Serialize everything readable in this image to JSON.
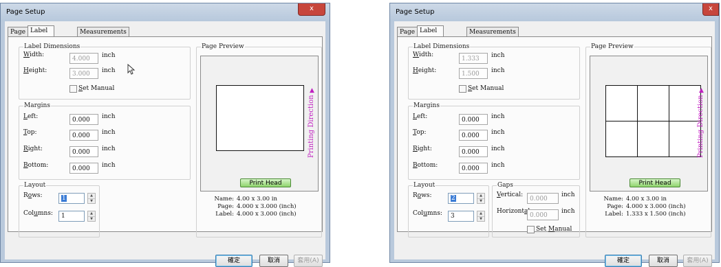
{
  "left": {
    "title": "Page Setup",
    "close_glyph": "x",
    "tabs": [
      "Page",
      "Label Layout",
      "Measurements"
    ],
    "label_dimensions": {
      "group_title": "Label Dimensions",
      "width_label_key": "W",
      "width_label_rest": "idth:",
      "width_value": "4.000",
      "width_unit": "inch",
      "height_label_key": "H",
      "height_label_rest": "eight:",
      "height_value": "3.000",
      "height_unit": "inch",
      "set_manual_key": "S",
      "set_manual_rest": "et Manual"
    },
    "margins": {
      "group_title": "Margins",
      "left_key": "L",
      "left_rest": "eft:",
      "left_value": "0.000",
      "top_key": "T",
      "top_rest": "op:",
      "top_value": "0.000",
      "right_key": "R",
      "right_rest": "ight:",
      "right_value": "0.000",
      "bottom_key": "B",
      "bottom_rest": "ottom:",
      "bottom_value": "0.000",
      "unit": "inch"
    },
    "layout": {
      "group_title": "Layout",
      "rows_label_pre": "R",
      "rows_label_key": "o",
      "rows_label_post": "ws:",
      "rows_value": "1",
      "columns_label_pre": "Col",
      "columns_label_key": "u",
      "columns_label_post": "mns:",
      "columns_value": "1"
    },
    "preview": {
      "group_title": "Page Preview",
      "direction_text": "Printing Direction",
      "print_head": "Print Head",
      "grid_rows": 1,
      "grid_cols": 1,
      "info": [
        {
          "k": "Name:",
          "v": "4.00 x 3.00 in"
        },
        {
          "k": "Page:",
          "v": "4.000 x 3.000 (inch)"
        },
        {
          "k": "Label:",
          "v": "4.000 x 3.000 (inch)"
        }
      ]
    },
    "buttons": {
      "ok": "確定",
      "cancel": "取消",
      "apply": "套用(A)"
    }
  },
  "right": {
    "title": "Page Setup",
    "close_glyph": "x",
    "tabs": [
      "Page",
      "Label Layout",
      "Measurements"
    ],
    "label_dimensions": {
      "group_title": "Label Dimensions",
      "width_label_key": "W",
      "width_label_rest": "idth:",
      "width_value": "1.333",
      "width_unit": "inch",
      "height_label_key": "H",
      "height_label_rest": "eight:",
      "height_value": "1.500",
      "height_unit": "inch",
      "set_manual_key": "S",
      "set_manual_rest": "et Manual"
    },
    "margins": {
      "group_title": "Margins",
      "left_key": "L",
      "left_rest": "eft:",
      "left_value": "0.000",
      "top_key": "T",
      "top_rest": "op:",
      "top_value": "0.000",
      "right_key": "R",
      "right_rest": "ight:",
      "right_value": "0.000",
      "bottom_key": "B",
      "bottom_rest": "ottom:",
      "bottom_value": "0.000",
      "unit": "inch"
    },
    "layout": {
      "group_title": "Layout",
      "rows_label_pre": "R",
      "rows_label_key": "o",
      "rows_label_post": "ws:",
      "rows_value": "2",
      "columns_label_pre": "Col",
      "columns_label_key": "u",
      "columns_label_post": "mns:",
      "columns_value": "3"
    },
    "gaps": {
      "group_title": "Gaps",
      "vertical_key": "V",
      "vertical_rest": "ertical:",
      "vertical_value": "0.000",
      "horizontal_pre": "Horizont",
      "horizontal_key": "a",
      "horizontal_post": "l:",
      "horizontal_value": "0.000",
      "unit": "inch",
      "set_manual_pre": "Set ",
      "set_manual_key": "M",
      "set_manual_post": "anual"
    },
    "preview": {
      "group_title": "Page Preview",
      "direction_text": "Printing Direction",
      "print_head": "Print Head",
      "grid_rows": 2,
      "grid_cols": 3,
      "info": [
        {
          "k": "Name:",
          "v": "4.00 x 3.00 in"
        },
        {
          "k": "Page:",
          "v": "4.000 x 3.000 (inch)"
        },
        {
          "k": "Label:",
          "v": "1.333 x 1.500 (inch)"
        }
      ]
    },
    "buttons": {
      "ok": "確定",
      "cancel": "取消",
      "apply": "套用(A)"
    }
  }
}
